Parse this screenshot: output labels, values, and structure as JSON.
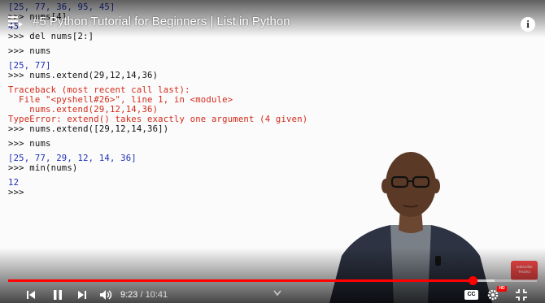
{
  "header": {
    "title": "#5 Python Tutorial for Beginners | List in Python",
    "info_symbol": "i"
  },
  "shell": {
    "lines": [
      {
        "cls": "out",
        "text": "[25, 77, 36, 95, 45]"
      },
      {
        "cls": "in",
        "text": ">>> nums[4]"
      },
      {
        "cls": "out",
        "text": "45"
      },
      {
        "cls": "in",
        "text": ">>> del nums[2:]"
      },
      {
        "cls": "in",
        "text": ""
      },
      {
        "cls": "in",
        "text": ">>> nums"
      },
      {
        "cls": "in",
        "text": ""
      },
      {
        "cls": "out",
        "text": "[25, 77]"
      },
      {
        "cls": "in",
        "text": ">>> nums.extend(29,12,14,36)"
      },
      {
        "cls": "in",
        "text": ""
      },
      {
        "cls": "err",
        "text": "Traceback (most recent call last):"
      },
      {
        "cls": "err",
        "text": "  File \"<pyshell#26>\", line 1, in <module>"
      },
      {
        "cls": "err",
        "text": "    nums.extend(29,12,14,36)"
      },
      {
        "cls": "err",
        "text": "TypeError: extend() takes exactly one argument (4 given)"
      },
      {
        "cls": "in",
        "text": ">>> nums.extend([29,12,14,36])"
      },
      {
        "cls": "in",
        "text": ""
      },
      {
        "cls": "in",
        "text": ">>> nums"
      },
      {
        "cls": "in",
        "text": ""
      },
      {
        "cls": "out",
        "text": "[25, 77, 29, 12, 14, 36]"
      },
      {
        "cls": "in",
        "text": ">>> min(nums)"
      },
      {
        "cls": "in",
        "text": ""
      },
      {
        "cls": "out",
        "text": "12"
      },
      {
        "cls": "in",
        "text": ">>>"
      }
    ]
  },
  "player": {
    "current_time": "9:23",
    "duration": "10:41",
    "time_separator": " / ",
    "progress_fraction": 0.878,
    "buffered_fraction": 0.92,
    "cc_label": "CC",
    "hd_label": "HD",
    "accent_color": "#ff0000"
  },
  "watermark": {
    "line1": "Subscribe",
    "line2": "Telusko"
  },
  "icons": [
    "queue-icon",
    "info-icon",
    "previous-icon",
    "pause-icon",
    "next-icon",
    "volume-icon",
    "chevron-down-icon",
    "captions-icon",
    "settings-icon",
    "fullscreen-exit-icon"
  ]
}
